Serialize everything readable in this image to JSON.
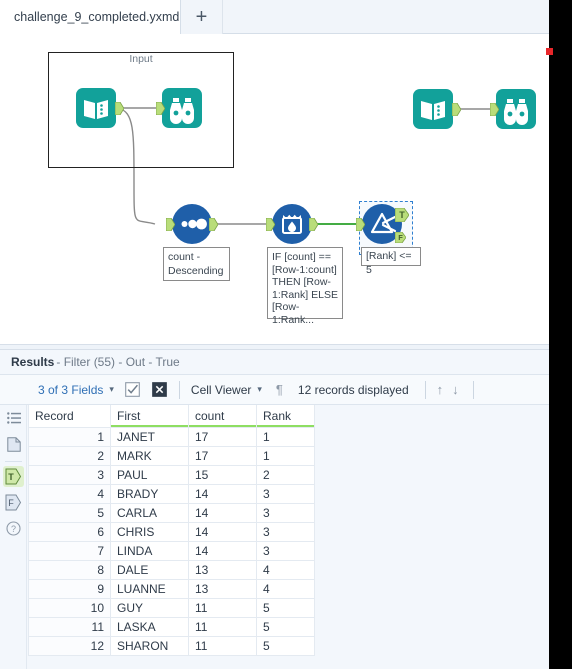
{
  "window": {
    "tabs": [
      {
        "label": "challenge_9_completed.yxmd",
        "close_icon": "close-icon",
        "active": true
      }
    ],
    "new_tab_label": "+"
  },
  "canvas": {
    "container": {
      "title": "Input"
    },
    "tools": [
      {
        "id": "input-data-1",
        "icon": "input-data-icon",
        "label": ""
      },
      {
        "id": "browse-1",
        "icon": "browse-icon",
        "label": ""
      },
      {
        "id": "input-data-2",
        "icon": "input-data-icon",
        "label": ""
      },
      {
        "id": "browse-2",
        "icon": "browse-icon",
        "label": ""
      },
      {
        "id": "sort-1",
        "icon": "sort-icon",
        "label": ""
      },
      {
        "id": "multi-row-formula-1",
        "icon": "multi-row-formula-icon",
        "label": ""
      },
      {
        "id": "filter-1",
        "icon": "filter-icon",
        "label": ""
      }
    ],
    "annotations": [
      {
        "id": "sort-annotation",
        "text": "count - Descending"
      },
      {
        "id": "multirow-annotation",
        "text": "IF [count] == [Row-1:count] THEN [Row-1:Rank] ELSE [Row-1:Rank..."
      },
      {
        "id": "filter-annotation",
        "text": "[Rank] <= 5"
      }
    ],
    "filter_outputs": [
      {
        "label": "T",
        "name": "true-output-anchor"
      },
      {
        "label": "F",
        "name": "false-output-anchor"
      }
    ]
  },
  "results": {
    "header": {
      "title": "Results",
      "subtitle": " - Filter (55) - Out - True"
    },
    "toolbar": {
      "fields_label": "3 of 3 Fields",
      "fields_caret": "▾",
      "select_all_icon": "checkbox-checked-icon",
      "deselect_all_icon": "checkbox-x-icon",
      "viewer_label": "Cell Viewer",
      "viewer_caret": "▾",
      "pilcrow_icon": "¶",
      "records_label": "12 records displayed",
      "up_arrow": "↑",
      "down_arrow": "↓"
    },
    "rail": [
      {
        "name": "list-view-icon",
        "glyph": "list",
        "selected": false
      },
      {
        "name": "profile-view-icon",
        "glyph": "page",
        "selected": false
      },
      {
        "name": "true-anchor-icon",
        "glyph": "T",
        "selected": true
      },
      {
        "name": "false-anchor-icon",
        "glyph": "F",
        "selected": false
      },
      {
        "name": "help-icon",
        "glyph": "?",
        "selected": false
      }
    ],
    "table": {
      "columns": [
        "Record",
        "First",
        "count",
        "Rank"
      ],
      "rows": [
        [
          "1",
          "JANET",
          "17",
          "1"
        ],
        [
          "2",
          "MARK",
          "17",
          "1"
        ],
        [
          "3",
          "PAUL",
          "15",
          "2"
        ],
        [
          "4",
          "BRADY",
          "14",
          "3"
        ],
        [
          "5",
          "CARLA",
          "14",
          "3"
        ],
        [
          "6",
          "CHRIS",
          "14",
          "3"
        ],
        [
          "7",
          "LINDA",
          "14",
          "3"
        ],
        [
          "8",
          "DALE",
          "13",
          "4"
        ],
        [
          "9",
          "LUANNE",
          "13",
          "4"
        ],
        [
          "10",
          "GUY",
          "11",
          "5"
        ],
        [
          "11",
          "LASKA",
          "11",
          "5"
        ],
        [
          "12",
          "SHARON",
          "11",
          "5"
        ]
      ]
    }
  },
  "colors": {
    "teal": "#12a19a",
    "blue": "#1f5fa9",
    "anchor_green": "#b9dd7a",
    "header_underline": "#8ede62",
    "selection_blue": "#2f7fd0",
    "link_blue": "#2f6fb5",
    "marker_red": "#e8262a"
  }
}
